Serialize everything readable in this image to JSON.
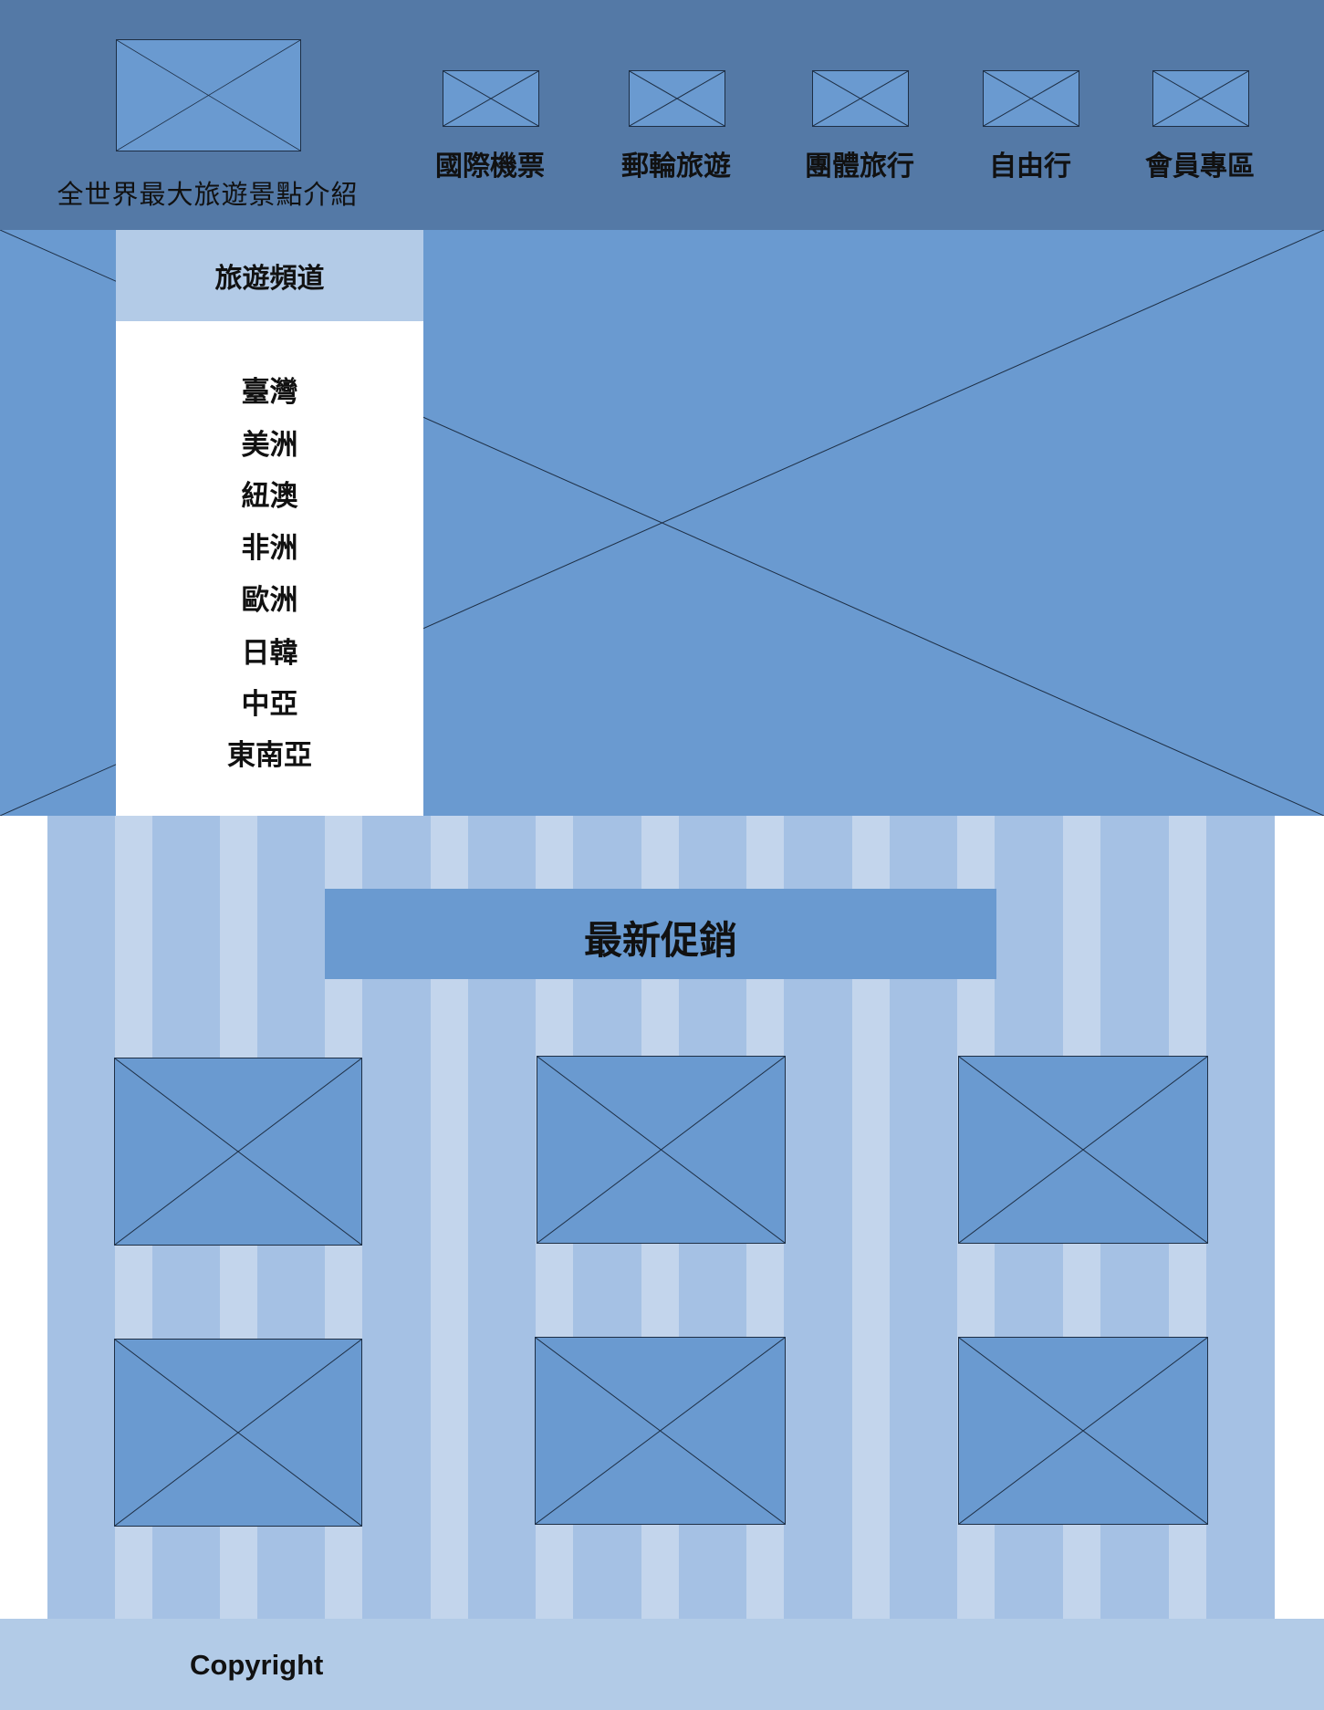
{
  "header": {
    "tagline": "全世界最大旅遊景點介紹",
    "nav": [
      {
        "label": "國際機票"
      },
      {
        "label": "郵輪旅遊"
      },
      {
        "label": "團體旅行"
      },
      {
        "label": "自由行"
      },
      {
        "label": "會員專區"
      }
    ]
  },
  "channel": {
    "title": "旅遊頻道",
    "regions": [
      "臺灣",
      "美洲",
      "紐澳",
      "非洲",
      "歐洲",
      "日韓",
      "中亞",
      "東南亞"
    ]
  },
  "promo": {
    "title": "最新促銷",
    "card_count": 6
  },
  "footer": {
    "copyright": "Copyright"
  },
  "colors": {
    "header_bg": "#5479a6",
    "placeholder": "#6a9ad0",
    "promo_bg": "#a5c1e4",
    "promo_stripe": "#c3d5ec",
    "footer_bg": "#b2cbe7"
  }
}
